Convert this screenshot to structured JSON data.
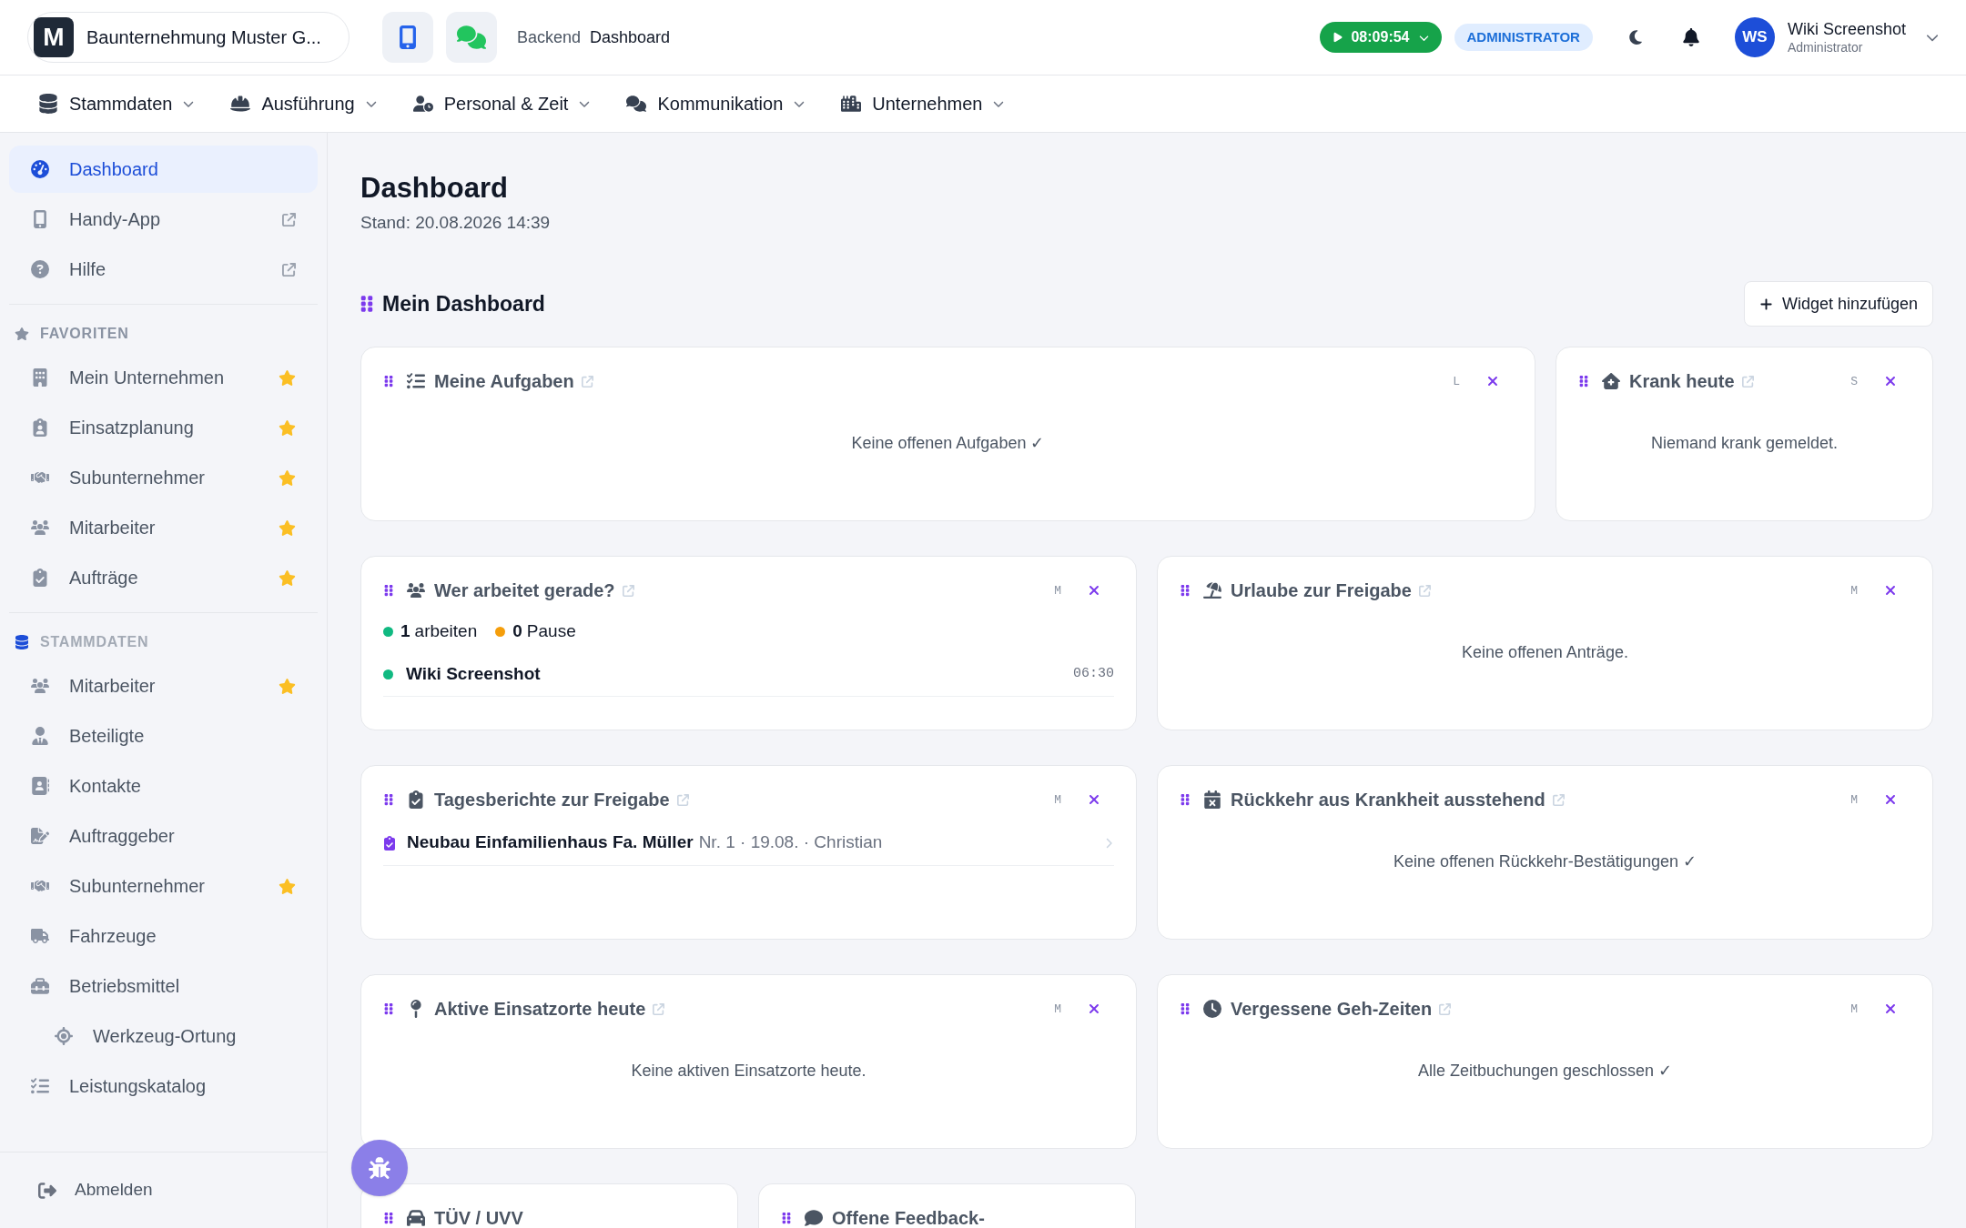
{
  "company": {
    "initial": "M",
    "name": "Baunternehmung Muster G..."
  },
  "breadcrumb": {
    "section": "Backend",
    "page": "Dashboard"
  },
  "timer": "08:09:54",
  "role": "ADMINISTRATOR",
  "user": {
    "initials": "WS",
    "name": "Wiki Screenshot",
    "role": "Administrator"
  },
  "nav": [
    {
      "label": "Stammdaten"
    },
    {
      "label": "Ausführung"
    },
    {
      "label": "Personal & Zeit"
    },
    {
      "label": "Kommunikation"
    },
    {
      "label": "Unternehmen"
    }
  ],
  "sidebar": {
    "top": [
      {
        "label": "Dashboard",
        "selected": true,
        "external": false
      },
      {
        "label": "Handy-App",
        "selected": false,
        "external": true
      },
      {
        "label": "Hilfe",
        "selected": false,
        "external": true
      }
    ],
    "sections": [
      {
        "title": "FAVORITEN",
        "items": [
          {
            "label": "Mein Unternehmen",
            "favorite": true
          },
          {
            "label": "Einsatzplanung",
            "favorite": true
          },
          {
            "label": "Subunternehmer",
            "favorite": true
          },
          {
            "label": "Mitarbeiter",
            "favorite": true
          },
          {
            "label": "Aufträge",
            "favorite": true
          }
        ]
      },
      {
        "title": "STAMMDATEN",
        "items": [
          {
            "label": "Mitarbeiter",
            "favorite": true
          },
          {
            "label": "Beteiligte",
            "favorite": false
          },
          {
            "label": "Kontakte",
            "favorite": false
          },
          {
            "label": "Auftraggeber",
            "favorite": false
          },
          {
            "label": "Subunternehmer",
            "favorite": true
          },
          {
            "label": "Fahrzeuge",
            "favorite": false
          },
          {
            "label": "Betriebsmittel",
            "favorite": false,
            "children": [
              {
                "label": "Werkzeug-Ortung",
                "favorite": false
              }
            ]
          },
          {
            "label": "Leistungskatalog",
            "favorite": false
          }
        ]
      }
    ],
    "logout": "Abmelden"
  },
  "page": {
    "title": "Dashboard",
    "stand": "Stand: 20.08.2026 14:39"
  },
  "dashboard": {
    "title": "Mein Dashboard",
    "add_button": "Widget hinzufügen"
  },
  "widgets": [
    [
      {
        "kind": "empty",
        "title": "Meine Aufgaben",
        "size": "L",
        "message": "Keine offenen Aufgaben ✓"
      },
      {
        "kind": "empty",
        "title": "Krank heute",
        "size": "S",
        "message": "Niemand krank gemeldet."
      }
    ],
    [
      {
        "kind": "working",
        "title": "Wer arbeitet gerade?",
        "size": "M",
        "stats": [
          {
            "count": "1",
            "label": "arbeiten",
            "color": "#10b981"
          },
          {
            "count": "0",
            "label": "Pause",
            "color": "#f59e0b"
          }
        ],
        "people": [
          {
            "name": "Wiki Screenshot",
            "time": "06:30",
            "color": "#10b981"
          }
        ]
      },
      {
        "kind": "empty",
        "title": "Urlaube zur Freigabe",
        "size": "M",
        "message": "Keine offenen Anträge."
      }
    ],
    [
      {
        "kind": "reports",
        "title": "Tagesberichte zur Freigabe",
        "size": "M",
        "reports": [
          {
            "title": "Neubau Einfamilienhaus Fa. Müller",
            "meta": "Nr. 1 · 19.08. · Christian"
          }
        ]
      },
      {
        "kind": "empty",
        "title": "Rückkehr aus Krankheit ausstehend",
        "size": "M",
        "message": "Keine offenen Rückkehr-Bestätigungen ✓"
      }
    ],
    [
      {
        "kind": "empty",
        "title": "Aktive Einsatzorte heute",
        "size": "M",
        "message": "Keine aktiven Einsatzorte heute."
      },
      {
        "kind": "empty",
        "title": "Vergessene Geh-Zeiten",
        "size": "M",
        "message": "Alle Zeitbuchungen geschlossen ✓"
      }
    ],
    [
      {
        "kind": "partial",
        "title": "TÜV / UVV"
      },
      {
        "kind": "partial",
        "title": "Offene Feedback-"
      }
    ]
  ]
}
